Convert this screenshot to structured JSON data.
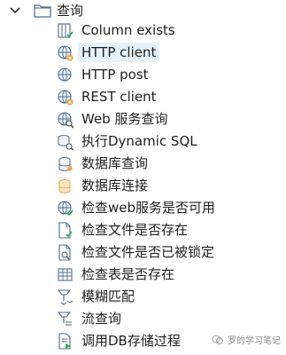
{
  "folder": {
    "label": "查询",
    "expanded": true
  },
  "items": [
    {
      "label": "Column exists",
      "icon": "column-check-icon"
    },
    {
      "label": "HTTP client",
      "icon": "globe-lock-icon",
      "selected": true
    },
    {
      "label": "HTTP post",
      "icon": "globe-icon"
    },
    {
      "label": "REST client",
      "icon": "globe-lock-icon"
    },
    {
      "label": "Web 服务查询",
      "icon": "globe-search-icon"
    },
    {
      "label": "执行Dynamic SQL",
      "icon": "sql-dynamic-icon"
    },
    {
      "label": "数据库查询",
      "icon": "database-search-icon"
    },
    {
      "label": "数据库连接",
      "icon": "database-link-icon"
    },
    {
      "label": "检查web服务是否可用",
      "icon": "globe-check-icon"
    },
    {
      "label": "检查文件是否存在",
      "icon": "file-check-icon"
    },
    {
      "label": "检查文件是否已被锁定",
      "icon": "file-lock-icon"
    },
    {
      "label": "检查表是否存在",
      "icon": "table-check-icon"
    },
    {
      "label": "模糊匹配",
      "icon": "fuzzy-match-icon"
    },
    {
      "label": "流查询",
      "icon": "stream-lookup-icon"
    },
    {
      "label": "调用DB存储过程",
      "icon": "db-procedure-icon"
    }
  ],
  "watermark": {
    "text": "罗的学习笔记"
  }
}
